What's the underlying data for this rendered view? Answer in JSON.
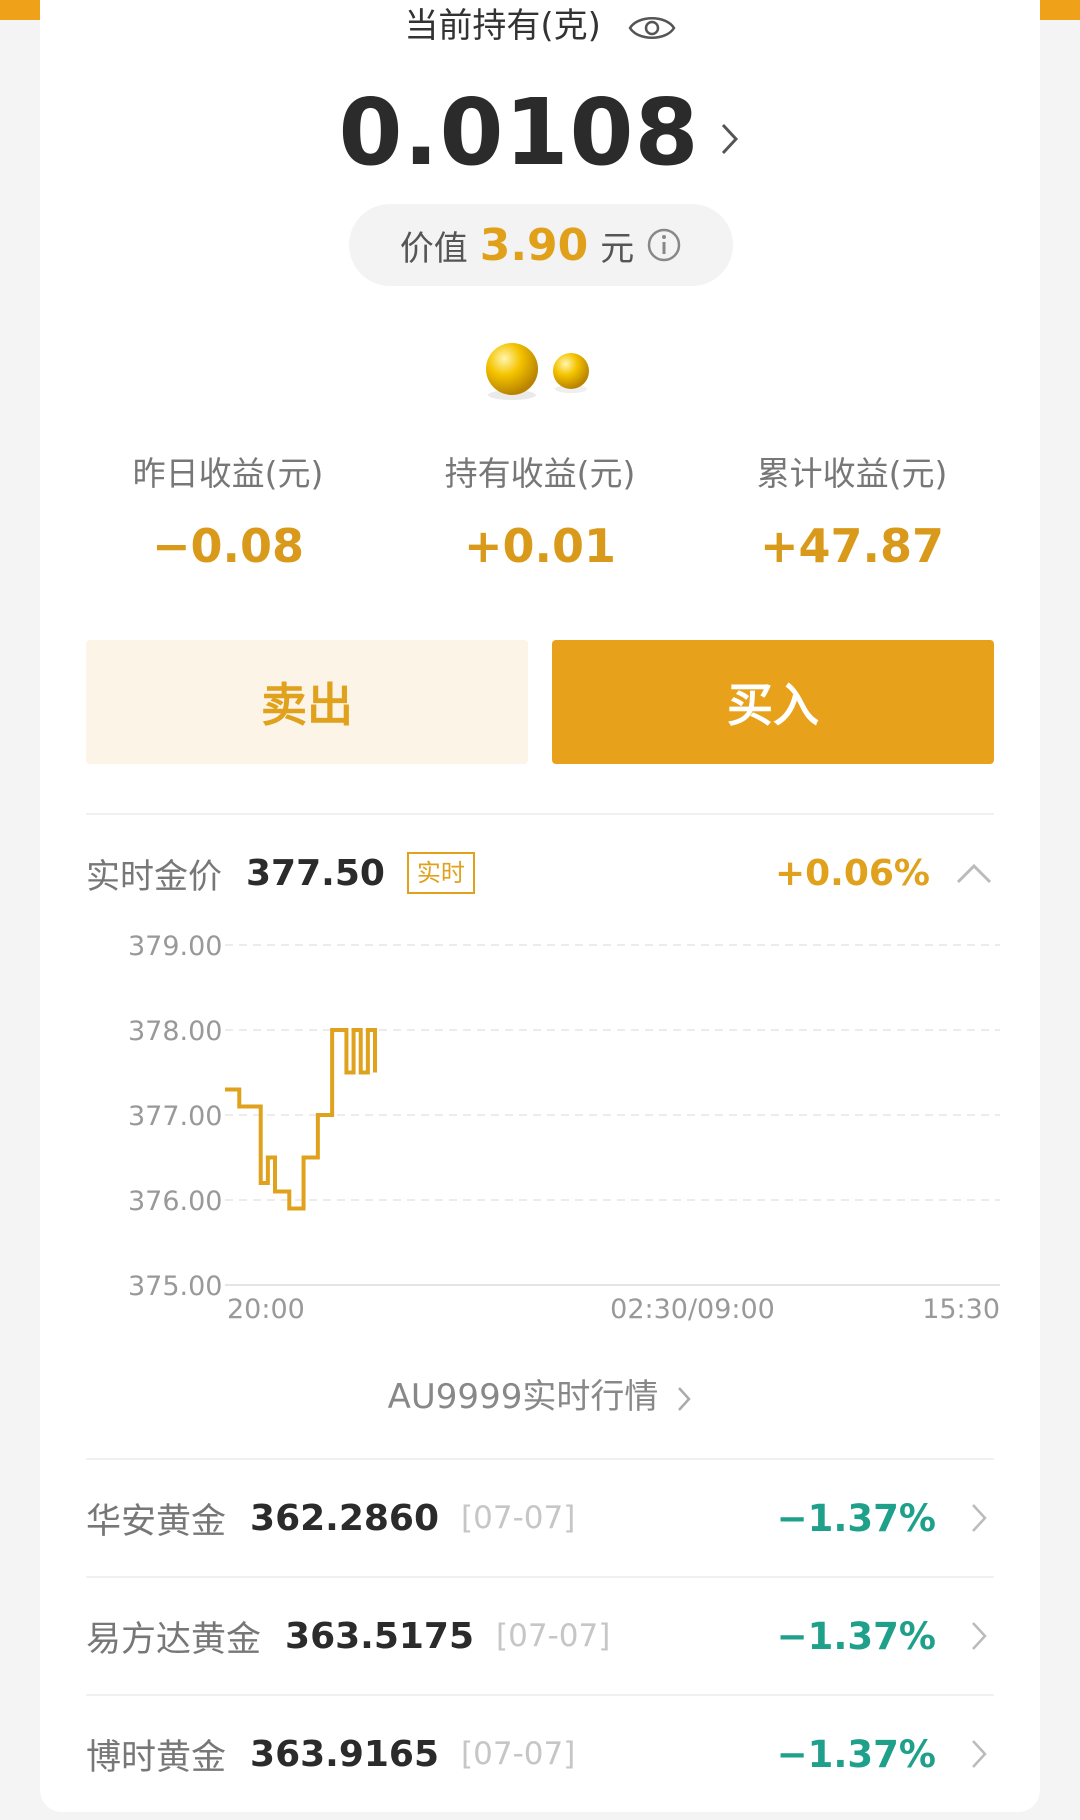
{
  "holding": {
    "label": "当前持有(克)",
    "value": "0.0108",
    "worth_prefix": "价值",
    "worth_amount": "3.90",
    "worth_unit": "元"
  },
  "stats": [
    {
      "label": "昨日收益(元)",
      "value": "−0.08"
    },
    {
      "label": "持有收益(元)",
      "value": "+0.01"
    },
    {
      "label": "累计收益(元)",
      "value": "+47.87"
    }
  ],
  "actions": {
    "sell": "卖出",
    "buy": "买入"
  },
  "realtime": {
    "label": "实时金价",
    "price": "377.50",
    "badge": "实时",
    "change": "+0.06%"
  },
  "chart_data": {
    "type": "line",
    "y_ticks": [
      "379.00",
      "378.00",
      "377.00",
      "376.00",
      "375.00"
    ],
    "ylim": [
      375,
      379
    ],
    "x_ticks": [
      "20:00",
      "02:30/09:00",
      "15:30"
    ],
    "series": [
      {
        "color": "#e0a11c",
        "values": [
          377.3,
          377.3,
          377.1,
          377.1,
          377.1,
          376.2,
          376.5,
          376.1,
          376.1,
          375.9,
          375.9,
          376.5,
          376.5,
          377.0,
          377.0,
          378.0,
          378.0,
          377.5,
          378.0,
          377.5,
          378.0,
          377.5
        ]
      }
    ]
  },
  "au_link": "AU9999实时行情",
  "funds": [
    {
      "name": "华安黄金",
      "nav": "362.2860",
      "date": "[07-07]",
      "change": "−1.37%"
    },
    {
      "name": "易方达黄金",
      "nav": "363.5175",
      "date": "[07-07]",
      "change": "−1.37%"
    },
    {
      "name": "博时黄金",
      "nav": "363.9165",
      "date": "[07-07]",
      "change": "−1.37%"
    }
  ],
  "colors": {
    "accent": "#e7a11a",
    "negative": "#1fa08a"
  }
}
